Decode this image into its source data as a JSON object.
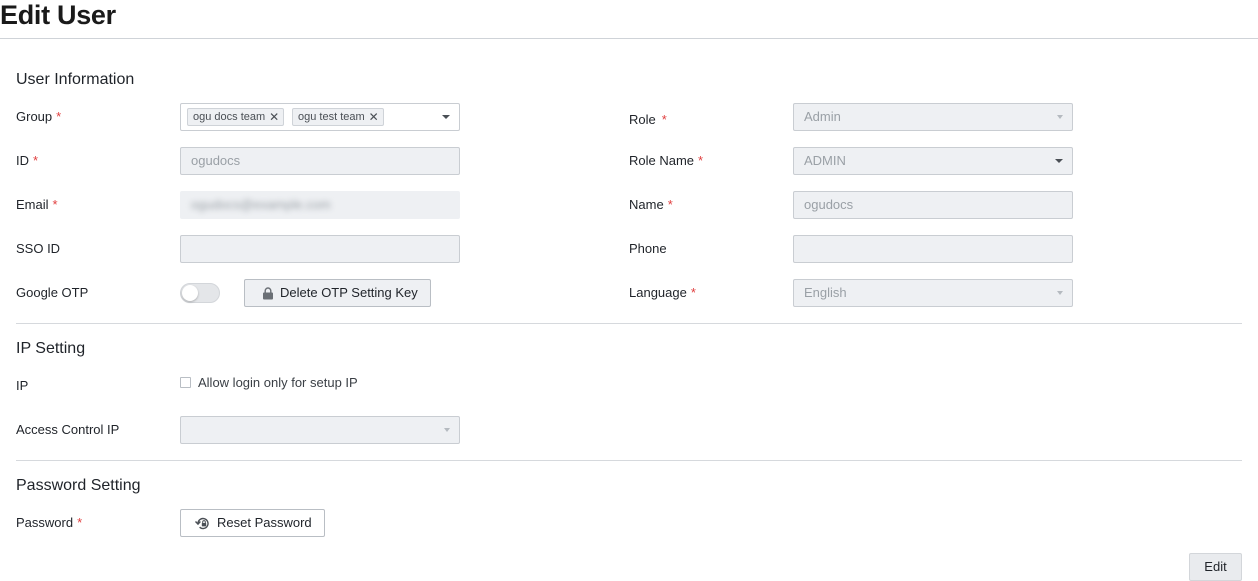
{
  "page": {
    "title": "Edit User"
  },
  "user_info": {
    "title": "User Information",
    "group": {
      "label": "Group",
      "tags": [
        "ogu docs team",
        "ogu test team"
      ]
    },
    "id": {
      "label": "ID",
      "value": "ogudocs"
    },
    "email": {
      "label": "Email",
      "value": "ogudocs@example.com"
    },
    "sso_id": {
      "label": "SSO ID",
      "value": ""
    },
    "google_otp": {
      "label": "Google OTP",
      "enabled": false,
      "delete_button": "Delete OTP Setting Key"
    },
    "role": {
      "label": "Role",
      "value": "Admin"
    },
    "role_name": {
      "label": "Role Name",
      "value": "ADMIN"
    },
    "name": {
      "label": "Name",
      "value": "ogudocs"
    },
    "phone": {
      "label": "Phone",
      "value": ""
    },
    "language": {
      "label": "Language",
      "value": "English"
    }
  },
  "ip_setting": {
    "title": "IP Setting",
    "ip": {
      "label": "IP",
      "checkbox_label": "Allow login only for setup IP",
      "checked": false
    },
    "access_control_ip": {
      "label": "Access Control IP",
      "value": ""
    }
  },
  "password_setting": {
    "title": "Password Setting",
    "password": {
      "label": "Password",
      "reset_button": "Reset Password"
    }
  },
  "footer": {
    "edit_button": "Edit"
  },
  "colors": {
    "required": "#e03e3e",
    "field_bg": "#eef0f3",
    "border": "#c9cdd2"
  }
}
